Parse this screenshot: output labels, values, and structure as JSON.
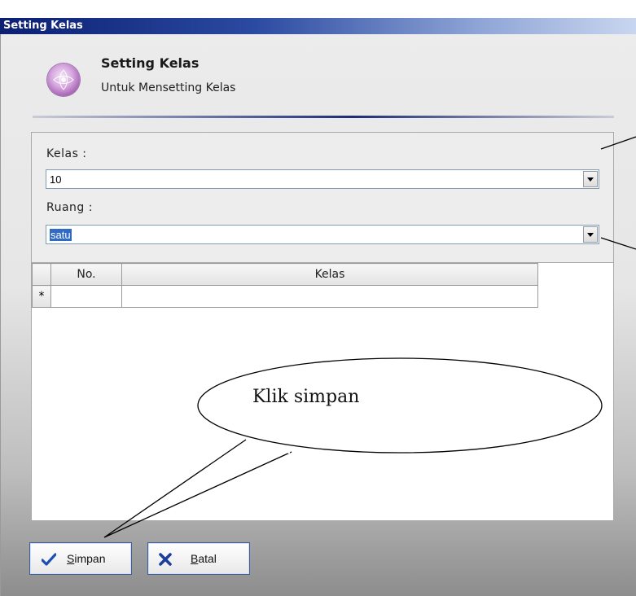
{
  "window": {
    "title": "Setting Kelas"
  },
  "header": {
    "title": "Setting Kelas",
    "subtitle": "Untuk Mensetting Kelas",
    "icon": "app-logo-icon"
  },
  "form": {
    "kelas": {
      "label": "Kelas :",
      "value": "10"
    },
    "ruang": {
      "label": "Ruang :",
      "value": "satu"
    }
  },
  "grid": {
    "columns": [
      "No.",
      "Kelas"
    ],
    "new_row_marker": "*"
  },
  "buttons": {
    "save": {
      "label_prefix": "",
      "mnemonic": "S",
      "label_rest": "impan",
      "icon": "checkmark-icon"
    },
    "cancel": {
      "label_prefix": "",
      "mnemonic": "B",
      "label_rest": "atal",
      "icon": "x-icon"
    }
  },
  "annotation": {
    "callout": "Klik simpan"
  },
  "colors": {
    "title_bar": "#0b1f73",
    "selection": "#316ac5",
    "button_border": "#3b5f9c"
  }
}
